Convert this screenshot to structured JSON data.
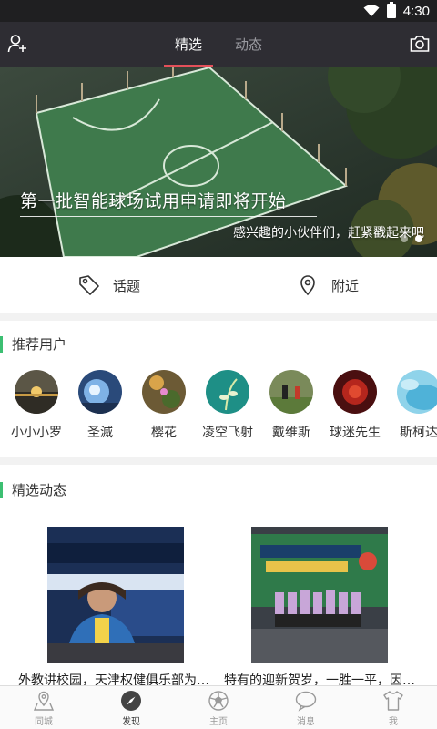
{
  "status_bar": {
    "time": "4:30",
    "wifi_icon": "wifi-icon",
    "battery_icon": "battery-icon"
  },
  "app_bar": {
    "left_icon": "add-user-icon",
    "right_icon": "camera-icon",
    "tabs": [
      {
        "label": "精选",
        "active": true
      },
      {
        "label": "动态",
        "active": false
      }
    ],
    "accent": "#e4505a"
  },
  "banner": {
    "title": "第一批智能球场试用申请即将开始",
    "subtitle": "感兴趣的小伙伴们，赶紧戳起来吧",
    "pages": 2,
    "active_page": 2
  },
  "quick_links": [
    {
      "label": "话题",
      "icon": "tag-icon"
    },
    {
      "label": "附近",
      "icon": "location-pin-icon"
    }
  ],
  "recommended_users": {
    "title": "推荐用户",
    "accent": "#3cbf72",
    "users": [
      {
        "name": "小小小罗"
      },
      {
        "name": "圣滅"
      },
      {
        "name": "樱花"
      },
      {
        "name": "凌空飞射"
      },
      {
        "name": "戴维斯"
      },
      {
        "name": "球迷先生"
      },
      {
        "name": "斯柯达"
      }
    ]
  },
  "featured_posts": {
    "title": "精选动态",
    "posts": [
      {
        "caption": "外教讲校园，天津权健俱乐部为…"
      },
      {
        "caption": "特有的迎新贺岁，一胜一平，因…"
      }
    ]
  },
  "bottom_nav": [
    {
      "label": "同城",
      "icon": "location-icon",
      "active": false
    },
    {
      "label": "发现",
      "icon": "compass-icon",
      "active": true
    },
    {
      "label": "主页",
      "icon": "soccer-ball-icon",
      "active": false
    },
    {
      "label": "消息",
      "icon": "chat-bubble-icon",
      "active": false
    },
    {
      "label": "我",
      "icon": "jersey-icon",
      "active": false
    }
  ]
}
